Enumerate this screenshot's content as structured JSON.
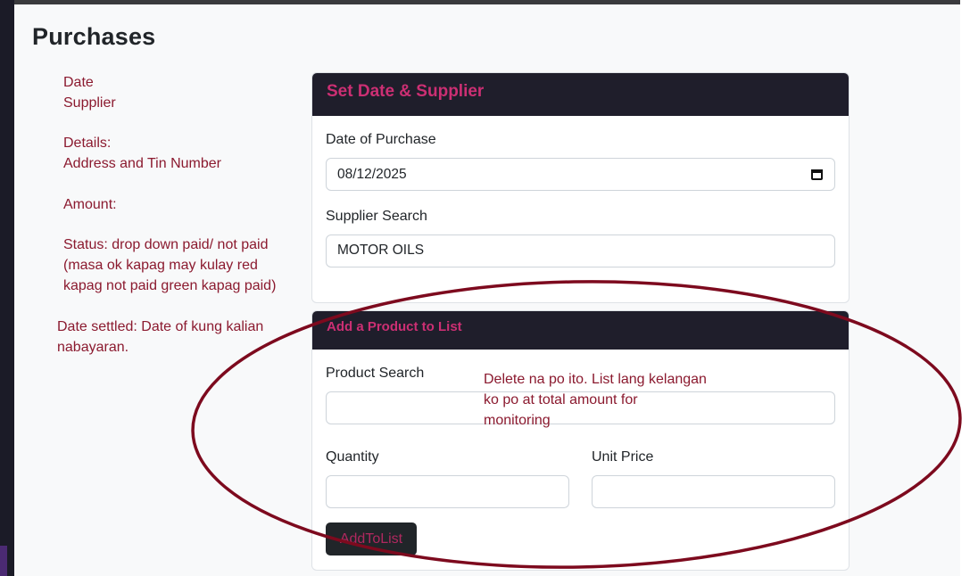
{
  "page": {
    "title": "Purchases"
  },
  "notes": {
    "fields": "Date\nSupplier",
    "details": "Details:\nAddress and Tin Number",
    "amount": "Amount:",
    "status": "Status: drop down paid/ not paid\n(masa ok kapag may kulay red\nkapag not paid green kapag paid)",
    "settled": "Date settled: Date of kung kalian\nnabayaran.",
    "delete": "Delete na po ito. List lang kelangan\nko po at total amount for\nmonitoring"
  },
  "supplier_card": {
    "header": "Set Date & Supplier",
    "date_label": "Date of Purchase",
    "date_value": "08/12/2025",
    "supplier_label": "Supplier Search",
    "supplier_value": "MOTOR OILS"
  },
  "product_card": {
    "header": "Add a Product to List",
    "product_label": "Product Search",
    "product_value": "",
    "quantity_label": "Quantity",
    "quantity_value": "",
    "unit_price_label": "Unit Price",
    "unit_price_value": "",
    "add_button": "AddToList"
  },
  "colors": {
    "annotation": "#7d0a1e",
    "header_bg": "#1f1e2b",
    "header_text": "#cc2f73"
  }
}
